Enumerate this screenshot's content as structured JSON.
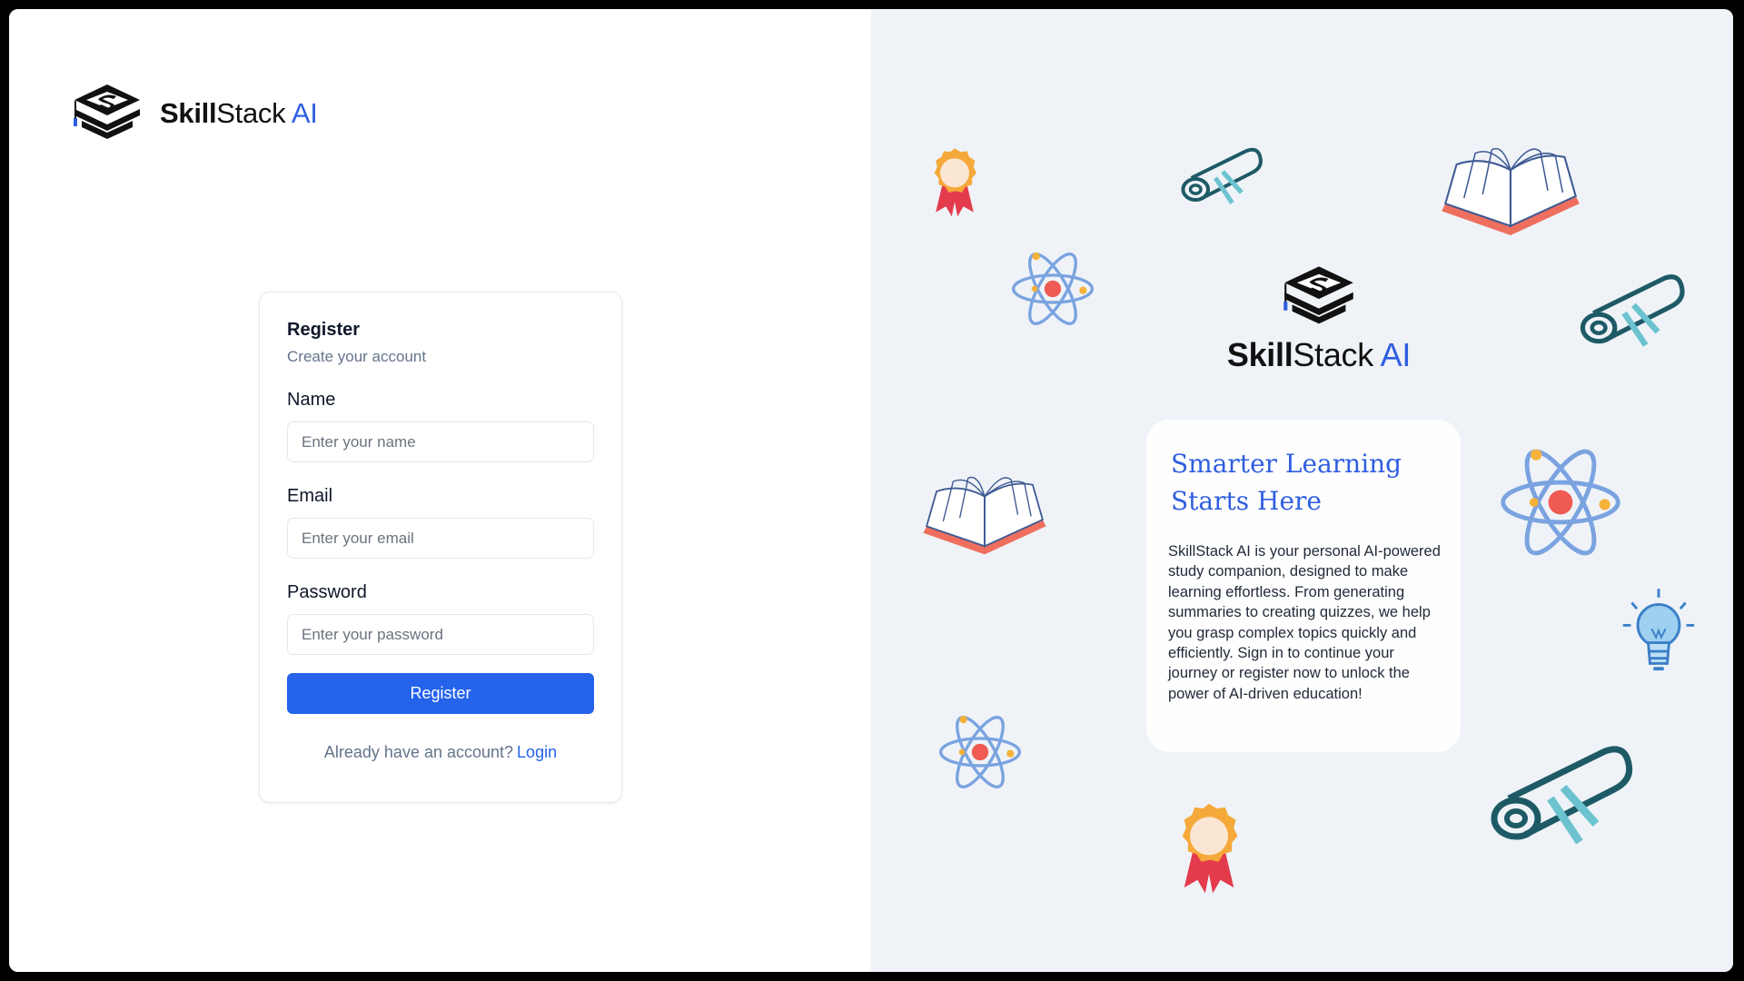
{
  "brand": {
    "part1": "Skill",
    "part2": "Stack",
    "part3": " AI"
  },
  "form": {
    "title": "Register",
    "subtitle": "Create your account",
    "fields": [
      {
        "label": "Name",
        "placeholder": "Enter your name",
        "value": ""
      },
      {
        "label": "Email",
        "placeholder": "Enter your email",
        "value": ""
      },
      {
        "label": "Password",
        "placeholder": "Enter your password",
        "value": ""
      }
    ],
    "submit_label": "Register",
    "login_prompt": "Already have an account?",
    "login_link": "Login"
  },
  "hero": {
    "title_line1": "Smarter Learning",
    "title_line2": "Starts Here",
    "description": "SkillStack AI is your personal AI-powered study companion, designed to make learning effortless. From generating summaries to creating quizzes, we help you grasp complex topics quickly and efficiently. Sign in to continue your journey or register now to unlock the power of AI-driven education!"
  },
  "icons": {
    "logo": "graduation-cap-stack-icon",
    "decorations": [
      "award-ribbon-icon",
      "diploma-scroll-icon",
      "open-book-icon",
      "atom-icon",
      "lightbulb-icon"
    ]
  },
  "colors": {
    "accent": "#2563eb",
    "brand_blue": "#2f5fe0",
    "right_bg": "#eff3f8",
    "teal": "#1d5a66",
    "light_teal": "#6cc3cf",
    "coral": "#ef6f5e",
    "gold": "#f5a93a",
    "red": "#e33b4c",
    "atom_blue": "#7aa3e0"
  }
}
